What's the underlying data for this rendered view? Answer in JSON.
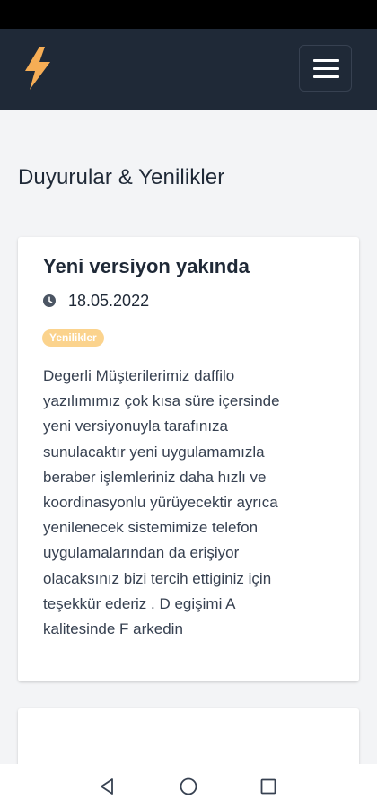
{
  "header": {
    "logo_icon": "lightning-bolt-icon",
    "menu_icon": "hamburger-menu-icon",
    "brand_color": "#f6ad55",
    "background": "#1f2937"
  },
  "page": {
    "heading": "Duyurular & Yenilikler"
  },
  "announcements": [
    {
      "title": "Yeni versiyon yakında",
      "date_icon": "clock-icon",
      "date": "18.05.2022",
      "badge": "Yenilikler",
      "badge_color": "#fbd38d",
      "body_lines": [
        "Degerli Müşterilerimiz daffilo",
        "yazılımımız çok kısa süre içersinde",
        "yeni versiyonuyla tarafınıza",
        "sunulacaktır yeni uygulamamızla",
        "beraber işlemleriniz daha hızlı ve",
        "koordinasyonlu yürüyecektir ayrıca",
        "yenilenecek sistemimize telefon",
        "uygulamalarından da erişiyor",
        "olacaksınız bizi tercih ettiginiz için",
        "teşekkür ederiz . D egişimi A",
        "kalitesinde F arkedin"
      ]
    }
  ],
  "system_nav": {
    "back_icon": "back-triangle-icon",
    "home_icon": "home-circle-icon",
    "recents_icon": "recents-square-icon"
  }
}
